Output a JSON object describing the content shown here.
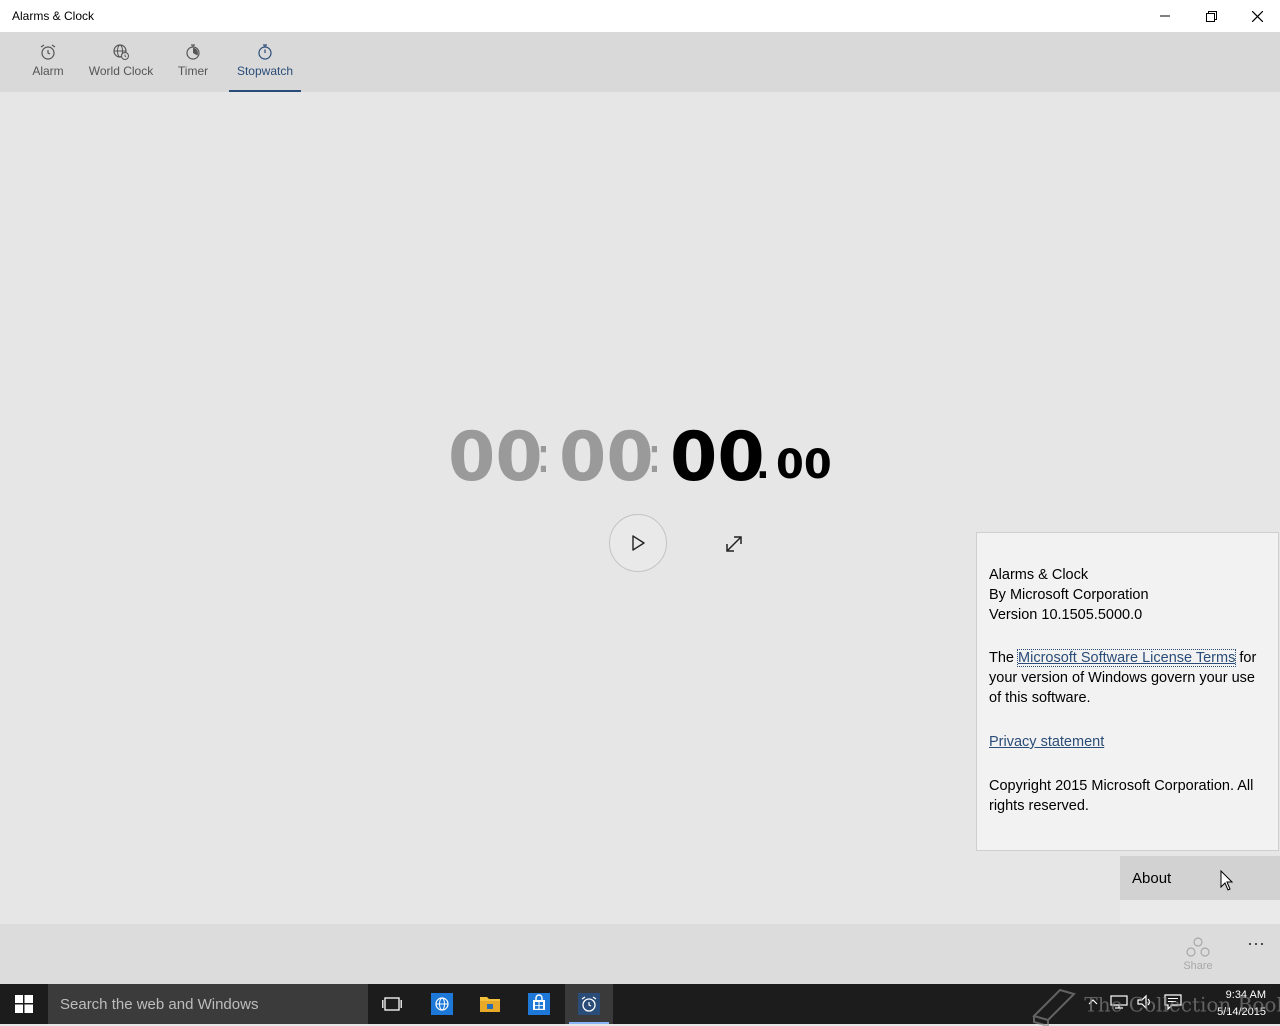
{
  "window": {
    "title": "Alarms & Clock",
    "controls": [
      "minimize",
      "restore",
      "close"
    ]
  },
  "nav": {
    "tabs": [
      {
        "label": "Alarm",
        "icon": "alarm-clock-icon",
        "active": false
      },
      {
        "label": "World Clock",
        "icon": "globe-clock-icon",
        "active": false
      },
      {
        "label": "Timer",
        "icon": "timer-icon",
        "active": false
      },
      {
        "label": "Stopwatch",
        "icon": "stopwatch-icon",
        "active": true
      }
    ]
  },
  "stopwatch": {
    "hours": "00",
    "minutes": "00",
    "seconds": "00",
    "hundredths": "00",
    "sep1": ":",
    "sep2": ":",
    "dot": "."
  },
  "about": {
    "app_name": "Alarms & Clock",
    "publisher": "By Microsoft Corporation",
    "version": "Version 10.1505.5000.0",
    "license_pre": "The ",
    "license_link": "Microsoft Software License Terms",
    "license_post": " for your version of Windows govern your use of this software.",
    "privacy_link": "Privacy statement",
    "copyright": "Copyright 2015 Microsoft Corporation. All rights reserved."
  },
  "menu": {
    "about_label": "About"
  },
  "commandbar": {
    "share_label": "Share",
    "more_label": "···"
  },
  "taskbar": {
    "search_placeholder": "Search the web and Windows",
    "time": "9:34 AM",
    "date": "5/14/2015",
    "watermark": "The Collection Book"
  },
  "colors": {
    "accent": "#2a4c78",
    "background": "#e6e6e6",
    "nav_bg": "#d9d9d9",
    "taskbar": "#1c1c1c"
  }
}
